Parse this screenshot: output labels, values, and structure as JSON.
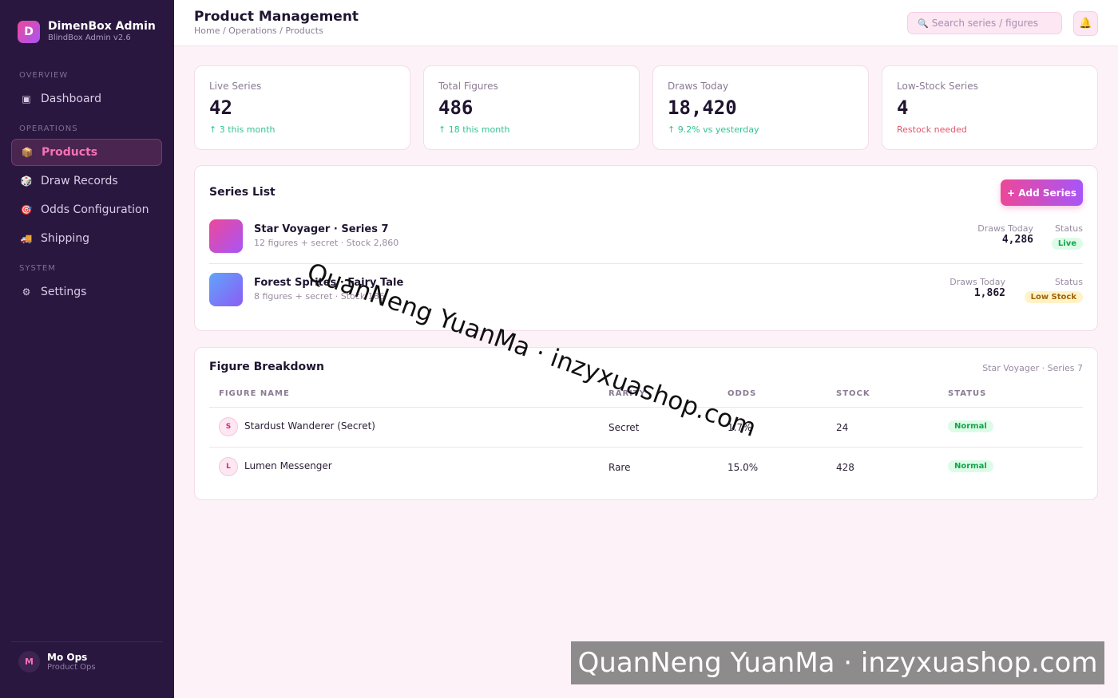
{
  "brand": {
    "logo_letter": "D",
    "title": "DimenBox Admin",
    "subtitle": "BlindBox Admin v2.6"
  },
  "sidebar": {
    "sections": [
      "OVERVIEW",
      "OPERATIONS",
      "SYSTEM"
    ],
    "items": [
      {
        "label": "Dashboard",
        "icon": "dashboard-icon",
        "glyph": "▣"
      },
      {
        "label": "Products",
        "icon": "package-icon",
        "glyph": "📦",
        "active": true
      },
      {
        "label": "Draw Records",
        "icon": "dice-icon",
        "glyph": "🎲"
      },
      {
        "label": "Odds Configuration",
        "icon": "target-icon",
        "glyph": "🎯"
      },
      {
        "label": "Shipping",
        "icon": "truck-icon",
        "glyph": "🚚"
      },
      {
        "label": "Settings",
        "icon": "gear-icon",
        "glyph": "⚙"
      }
    ]
  },
  "user": {
    "initial": "M",
    "name": "Mo Ops",
    "role": "Product Ops"
  },
  "header": {
    "title": "Product Management",
    "breadcrumb": "Home / Operations / Products",
    "search_placeholder": "Search series / figures",
    "search_icon": "🔍",
    "bell_icon": "🔔"
  },
  "stats": [
    {
      "label": "Live Series",
      "value": "42",
      "trend": "↑ 3 this month"
    },
    {
      "label": "Total Figures",
      "value": "486",
      "trend": "↑ 18 this month"
    },
    {
      "label": "Draws Today",
      "value": "18,420",
      "trend": "↑ 9.2% vs yesterday"
    },
    {
      "label": "Low-Stock Series",
      "value": "4",
      "trend": "Restock needed"
    }
  ],
  "series_list": {
    "title": "Series List",
    "add_button": "+ Add Series",
    "rows": [
      {
        "name": "Star Voyager · Series 7",
        "meta": "12 figures + secret · Stock 2,860",
        "draws_label": "Draws Today",
        "draws": "4,286",
        "status_label": "Status",
        "status": "Live",
        "color_from": "#ec4899",
        "color_to": "#a855f7"
      },
      {
        "name": "Forest Sprites · Fairy Tale",
        "meta": "8 figures + secret · Stock 186",
        "draws_label": "Draws Today",
        "draws": "1,862",
        "status_label": "Status",
        "status": "Low Stock",
        "color_from": "#60a5fa",
        "color_to": "#8b5cf6"
      }
    ]
  },
  "figure_breakdown": {
    "title": "Figure Breakdown",
    "series": "Star Voyager · Series 7",
    "columns": [
      "FIGURE NAME",
      "RARITY",
      "ODDS",
      "STOCK",
      "STATUS"
    ],
    "rows": [
      {
        "initial": "S",
        "name": "Stardust Wanderer (Secret)",
        "rarity": "Secret",
        "odds": "1.7%",
        "stock": "24",
        "status": "Normal"
      },
      {
        "initial": "L",
        "name": "Lumen Messenger",
        "rarity": "Rare",
        "odds": "15.0%",
        "stock": "428",
        "status": "Normal"
      }
    ]
  },
  "watermark": {
    "text": "QuanNeng YuanMa · inzyxuashop.com"
  }
}
